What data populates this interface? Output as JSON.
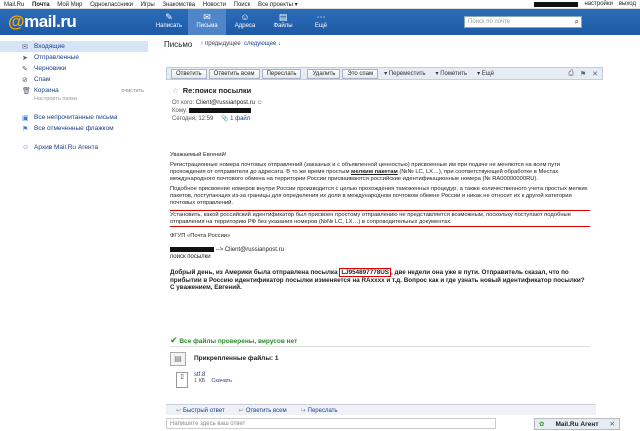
{
  "topbar": {
    "links": [
      "Mail.Ru",
      "Почта",
      "Мой Мир",
      "Одноклассники",
      "Игры",
      "Знакомства",
      "Новости",
      "Поиск",
      "Все проекты ▾"
    ],
    "right": [
      "настройки",
      "выход"
    ]
  },
  "header": {
    "logo_at": "@",
    "logo_text": "mail.ru",
    "nav": [
      {
        "label": "Написать",
        "icon": "✎"
      },
      {
        "label": "Письма",
        "icon": "✉"
      },
      {
        "label": "Адреса",
        "icon": "☺"
      },
      {
        "label": "Файлы",
        "icon": "▤"
      },
      {
        "label": "Ещё",
        "icon": "⋯"
      }
    ],
    "search_placeholder": "Поиск по почте"
  },
  "sidebar": {
    "folders": [
      {
        "label": "Входящие",
        "icon": "✉"
      },
      {
        "label": "Отправленные",
        "icon": "➤"
      },
      {
        "label": "Черновики",
        "icon": "✎"
      },
      {
        "label": "Спам",
        "icon": "⊘"
      },
      {
        "label": "Корзина",
        "icon": "🗑"
      }
    ],
    "clean": "очистить",
    "settings": "Настроить папки",
    "extra": [
      {
        "label": "Все непрочитанные письма",
        "icon": "▣"
      },
      {
        "label": "Все отмеченные флажком",
        "icon": "⚑"
      },
      {
        "label": "Архив Mail.Ru Агента",
        "icon": "☺"
      }
    ]
  },
  "main": {
    "title": "Письмо",
    "prev": "↑ предыдущее",
    "next": "следующее ↓"
  },
  "toolbar": {
    "buttons": [
      "Ответить",
      "Ответить всем",
      "Переслать"
    ],
    "buttons2": [
      "Удалить",
      "Это спам"
    ],
    "dropdowns": [
      "▾ Переместить",
      "▾ Пометить",
      "▾ Ещё"
    ],
    "icons": [
      "⎙",
      "⚑",
      "✕"
    ]
  },
  "message": {
    "subject": "Re:поиск посылки",
    "from_label": "От кого:",
    "from": "Client@russianpost.ru",
    "to_label": "Кому:",
    "date": "Сегодня, 12:59",
    "attach_link": "1 файл",
    "greeting": "Уважаемый Евгений!",
    "p1a": "Регистрационные номера почтовых отправлений (заказных и с объявленной ценностью) присвоенные им при подаче не меняются на всем пути прохождения от отправителя до адресата. В то же время простым ",
    "p1b": "мелким пакетам",
    "p1c": " (№№ LC, LX…), при соответствующей обработке в Местах международного почтового обмена на территории России присваиваются российские идентификационные номера (№ RA00000000RU).",
    "p2": "Подобное присвоение номеров внутри России производится с целью прохождения таможенных процедур, а также количественного учета простых мелких пакетов, поступающих из-за границы для определения их доли в международном почтовом обмене России и никак не относит их к другой категории почтовых отправлений.",
    "p3": "Установить, какой российский идентификатор был присвоен простому отправлению не представляется возможным, поскольку поступают подобные отправления на территорию РФ без указания номеров (№№ LC, LX…) в сопроводительных документах.",
    "signature": "ФГУП «Почта России»",
    "quote_arrow": "--> Client@russianpost.ru",
    "quote_subject": "поиск посылки",
    "q1": "Добрый день, из Америки была отправлена посылка ",
    "q_track": "LJ954897778US",
    "q2": ", две недели она уже в пути. Отправитель сказал, что по прибытии в Россию идентификатор посылки изменяется на RAxxxx и т.д.  Вопрос как и где узнать новый идентификатор посылки? С уважением, Евгений."
  },
  "scan": {
    "ok": "Все файлы проверены, вирусов нет",
    "attached": "Прикрепленные файлы: 1",
    "file_name": "stf.8",
    "file_size": "1 КБ",
    "download": "Скачать"
  },
  "reply": {
    "actions": [
      "Быстрый ответ",
      "Ответить всем",
      "Переслать"
    ],
    "quick_placeholder": "Напишите здесь ваш ответ",
    "agent": "Mail.Ru Агент"
  }
}
